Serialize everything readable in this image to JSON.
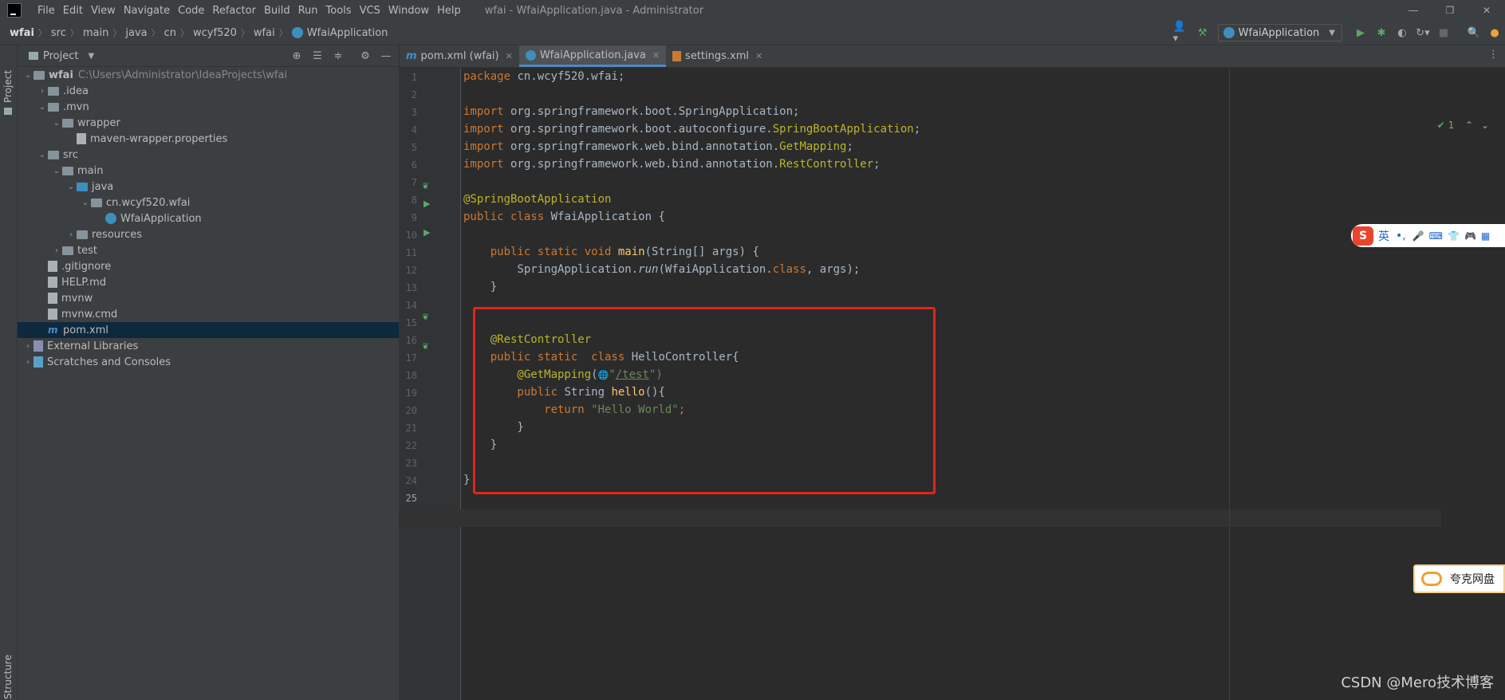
{
  "titlebar": {
    "menu": [
      "File",
      "Edit",
      "View",
      "Navigate",
      "Code",
      "Refactor",
      "Build",
      "Run",
      "Tools",
      "VCS",
      "Window",
      "Help"
    ],
    "window_title": "wfai - WfaiApplication.java - Administrator"
  },
  "breadcrumb": [
    "wfai",
    "src",
    "main",
    "java",
    "cn",
    "wcyf520",
    "wfai",
    "WfaiApplication"
  ],
  "toolbar": {
    "run_config": "WfaiApplication"
  },
  "left_strip": {
    "project_tab": "Project",
    "structure_tab": "Structure"
  },
  "project_panel": {
    "title": "Project",
    "tree": [
      {
        "label": "wfai",
        "hint": "C:\\Users\\Administrator\\IdeaProjects\\wfai",
        "level": 0,
        "arrow": "v",
        "icon": "folder"
      },
      {
        "label": ".idea",
        "level": 1,
        "arrow": ">",
        "icon": "folder"
      },
      {
        "label": ".mvn",
        "level": 1,
        "arrow": "v",
        "icon": "folder"
      },
      {
        "label": "wrapper",
        "level": 2,
        "arrow": "v",
        "icon": "folder"
      },
      {
        "label": "maven-wrapper.properties",
        "level": 3,
        "arrow": "",
        "icon": "file"
      },
      {
        "label": "src",
        "level": 1,
        "arrow": "v",
        "icon": "folder"
      },
      {
        "label": "main",
        "level": 2,
        "arrow": "v",
        "icon": "folder"
      },
      {
        "label": "java",
        "level": 3,
        "arrow": "v",
        "icon": "folder-blue"
      },
      {
        "label": "cn.wcyf520.wfai",
        "level": 4,
        "arrow": "v",
        "icon": "folder"
      },
      {
        "label": "WfaiApplication",
        "level": 5,
        "arrow": "",
        "icon": "class"
      },
      {
        "label": "resources",
        "level": 3,
        "arrow": ">",
        "icon": "folder"
      },
      {
        "label": "test",
        "level": 2,
        "arrow": ">",
        "icon": "folder"
      },
      {
        "label": ".gitignore",
        "level": 1,
        "arrow": "",
        "icon": "file"
      },
      {
        "label": "HELP.md",
        "level": 1,
        "arrow": "",
        "icon": "file"
      },
      {
        "label": "mvnw",
        "level": 1,
        "arrow": "",
        "icon": "file"
      },
      {
        "label": "mvnw.cmd",
        "level": 1,
        "arrow": "",
        "icon": "file"
      },
      {
        "label": "pom.xml",
        "level": 1,
        "arrow": "",
        "icon": "maven",
        "selected": true
      },
      {
        "label": "External Libraries",
        "level": 0,
        "arrow": ">",
        "icon": "lib"
      },
      {
        "label": "Scratches and Consoles",
        "level": 0,
        "arrow": ">",
        "icon": "scratch"
      }
    ]
  },
  "tabs": [
    {
      "label": "pom.xml (wfai)",
      "icon": "maven",
      "active": false
    },
    {
      "label": "WfaiApplication.java",
      "icon": "class",
      "active": true
    },
    {
      "label": "settings.xml",
      "icon": "xml",
      "active": false
    }
  ],
  "editor": {
    "inspection": "1",
    "line_numbers": [
      "1",
      "2",
      "3",
      "4",
      "5",
      "6",
      "7",
      "8",
      "9",
      "10",
      "11",
      "12",
      "13",
      "14",
      "15",
      "16",
      "17",
      "18",
      "19",
      "20",
      "21",
      "22",
      "23",
      "24",
      "25"
    ],
    "code": {
      "l1_kw": "package",
      "l1_rest": " cn.wcyf520.wfai;",
      "l3_kw": "import",
      "l3_rest": " org.springframework.boot.SpringApplication;",
      "l4_kw": "import",
      "l4_rest": " org.springframework.boot.autoconfigure.",
      "l4_ann": "SpringBootApplication",
      "l4_end": ";",
      "l5_kw": "import",
      "l5_rest": " org.springframework.web.bind.annotation.",
      "l5_ann": "GetMapping",
      "l5_end": ";",
      "l6_kw": "import",
      "l6_rest": " org.springframework.web.bind.annotation.",
      "l6_ann": "RestController",
      "l6_end": ";",
      "l8_ann": "@SpringBootApplication",
      "l9_kw": "public class",
      "l9_rest": " WfaiApplication {",
      "l11_kw": "    public static void",
      "l11_fn": " main",
      "l11_rest": "(String[] args) {",
      "l12_a": "        SpringApplication.",
      "l12_run": "run",
      "l12_b": "(WfaiApplication.",
      "l12_kw": "class",
      "l12_c": ", args);",
      "l13": "    }",
      "l16_ann": "    @RestController",
      "l17_kw": "    public static  class",
      "l17_rest": " HelloController{",
      "l18_ann": "        @GetMapping",
      "l18_a": "(",
      "l18_globe": "🌐",
      "l18_q": "\"",
      "l18_str": "/test",
      "l18_b": "\")",
      "l19_kw": "        public",
      "l19_a": " String ",
      "l19_fn": "hello",
      "l19_b": "(){",
      "l20_kw": "            return",
      "l20_str": " \"Hello World\"",
      "l20_end": ";",
      "l21": "        }",
      "l22": "    }",
      "l24": "}"
    }
  },
  "overlays": {
    "ime_logo": "S",
    "ime_lang": "英",
    "ime_punct": "•,",
    "ime_icons": [
      "🎤",
      "⌨",
      "👕",
      "🎮",
      "▦"
    ],
    "quark_label": "夸克网盘",
    "watermark": "CSDN @Mero技术博客"
  },
  "colors": {
    "highlight_box": "#e1251b",
    "keyword": "#cc7832",
    "annotation": "#bbb529",
    "string": "#6a8759",
    "function": "#ffc66d"
  }
}
